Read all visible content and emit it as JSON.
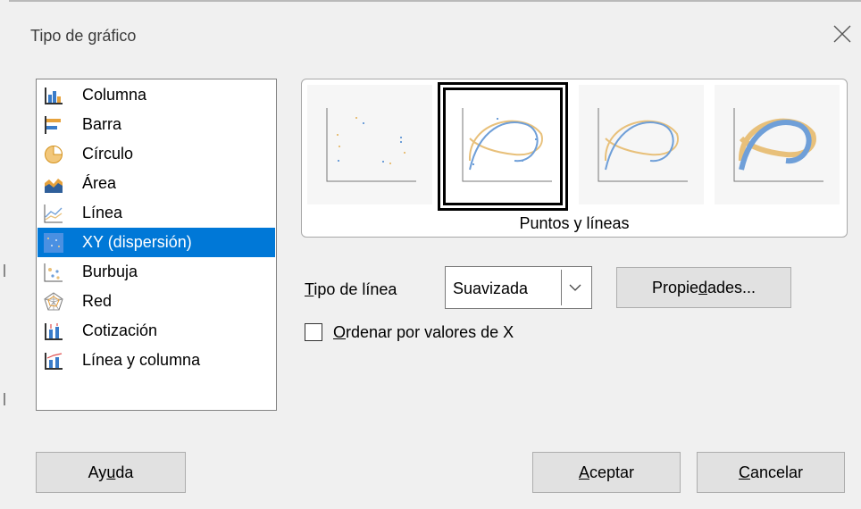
{
  "window": {
    "title": "Tipo de gráfico",
    "close_icon": "close-icon"
  },
  "chart_types": {
    "selected_index": 5,
    "items": [
      {
        "label": "Columna",
        "icon": "column-chart-icon"
      },
      {
        "label": "Barra",
        "icon": "bar-chart-icon"
      },
      {
        "label": "Círculo",
        "icon": "pie-chart-icon"
      },
      {
        "label": "Área",
        "icon": "area-chart-icon"
      },
      {
        "label": "Línea",
        "icon": "line-chart-icon"
      },
      {
        "label": "XY (dispersión)",
        "icon": "xy-scatter-icon"
      },
      {
        "label": "Burbuja",
        "icon": "bubble-chart-icon"
      },
      {
        "label": "Red",
        "icon": "net-chart-icon"
      },
      {
        "label": "Cotización",
        "icon": "stock-chart-icon"
      },
      {
        "label": "Línea y columna",
        "icon": "column-line-chart-icon"
      }
    ]
  },
  "variants": {
    "selected_index": 1,
    "caption": "Puntos y líneas",
    "items": [
      "points-only",
      "points-and-lines",
      "lines-only",
      "3d-lines"
    ]
  },
  "line_type": {
    "label_prefix": "",
    "label_accel": "T",
    "label_rest": "ipo de línea",
    "value": "Suavizada",
    "properties_prefix": "Propie",
    "properties_accel": "d",
    "properties_rest": "ades..."
  },
  "sort_by_x": {
    "label_accel": "O",
    "label_rest": "rdenar por valores de X",
    "checked": false
  },
  "buttons": {
    "help_prefix": "Ay",
    "help_accel": "u",
    "help_rest": "da",
    "ok_accel": "A",
    "ok_rest": "ceptar",
    "cancel_accel": "C",
    "cancel_rest": "ancelar"
  },
  "colors": {
    "selection": "#0078d7",
    "series_blue": "#6f9fd8",
    "series_orange": "#e8c07a"
  }
}
